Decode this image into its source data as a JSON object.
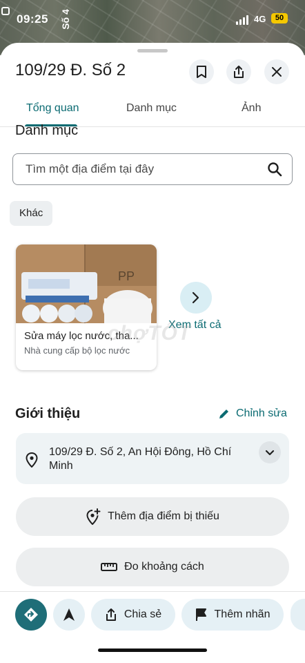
{
  "status_bar": {
    "time": "09:25",
    "rotated_label": "Số 4",
    "network": "4G",
    "battery": "50"
  },
  "place": {
    "title": "109/29 Đ. Số 2"
  },
  "tabs": [
    {
      "label": "Tổng quan",
      "active": true
    },
    {
      "label": "Danh mục",
      "active": false
    },
    {
      "label": "Ảnh",
      "active": false
    }
  ],
  "directory": {
    "heading": "Danh mục",
    "search_placeholder": "Tìm một địa điểm tại đây",
    "chip": "Khác",
    "card": {
      "name": "Sửa máy lọc nước, tha...",
      "category": "Nhà cung cấp bộ lọc nước"
    },
    "see_all": "Xem tất cả"
  },
  "intro": {
    "heading": "Giới thiệu",
    "edit": "Chỉnh sửa",
    "address": "109/29 Đ. Số 2, An Hội Đông, Hồ Chí Minh",
    "add_missing": "Thêm địa điểm bị thiếu",
    "measure": "Đo khoảng cách"
  },
  "actions": {
    "share": "Chia sẻ",
    "label": "Thêm nhãn"
  },
  "watermark": "chợTỐT",
  "colors": {
    "accent": "#0b6b72",
    "chip_bg": "#e5f0f5",
    "pill_bg": "#eceeef"
  }
}
